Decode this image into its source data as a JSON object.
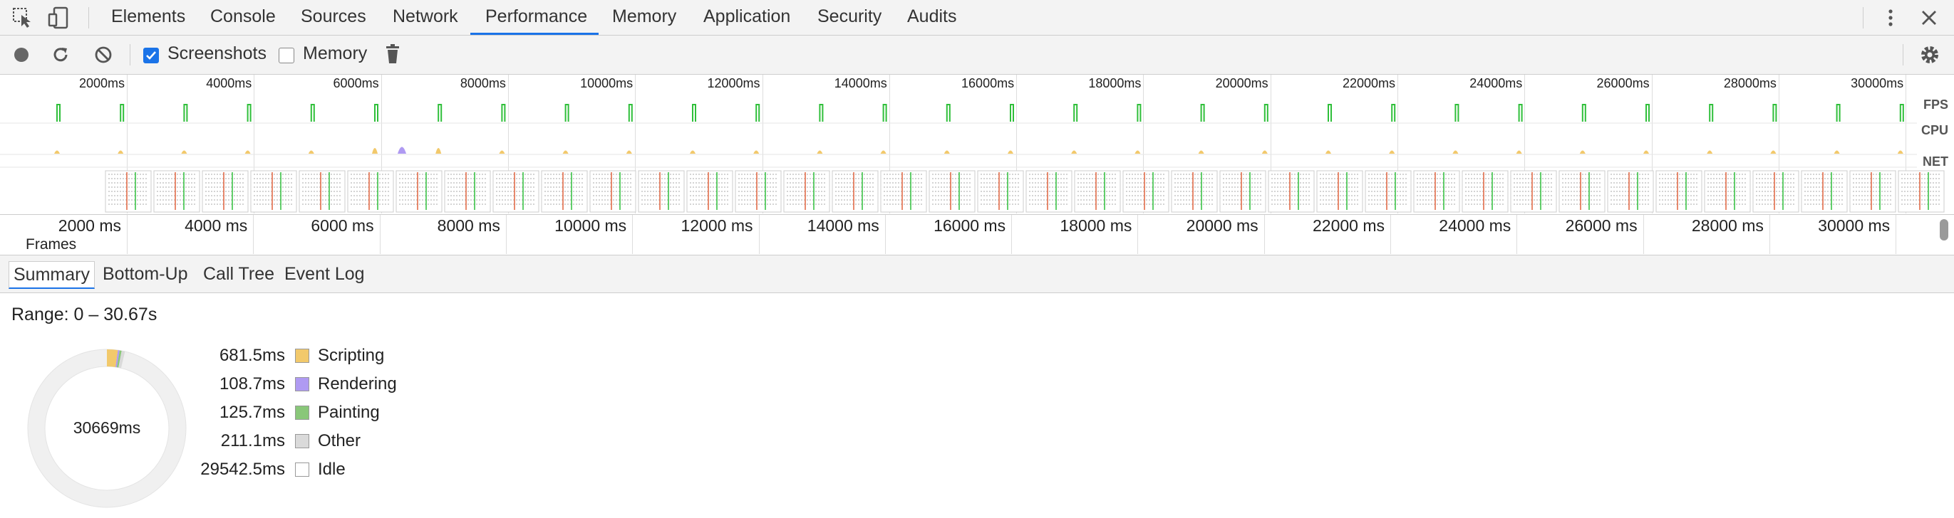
{
  "tabs": [
    {
      "label": "Elements"
    },
    {
      "label": "Console"
    },
    {
      "label": "Sources"
    },
    {
      "label": "Network"
    },
    {
      "label": "Performance",
      "active": true
    },
    {
      "label": "Memory"
    },
    {
      "label": "Application"
    },
    {
      "label": "Security"
    },
    {
      "label": "Audits"
    }
  ],
  "toolbar": {
    "screenshots_label": "Screenshots",
    "screenshots_checked": true,
    "memory_label": "Memory",
    "memory_checked": false
  },
  "overview": {
    "ticks": [
      "2000ms",
      "4000ms",
      "6000ms",
      "8000ms",
      "10000ms",
      "12000ms",
      "14000ms",
      "16000ms",
      "18000ms",
      "20000ms",
      "22000ms",
      "24000ms",
      "26000ms",
      "28000ms",
      "30000ms"
    ],
    "fps_label": "FPS",
    "cpu_label": "CPU",
    "net_label": "NET"
  },
  "ruler": {
    "ticks": [
      "2000 ms",
      "4000 ms",
      "6000 ms",
      "8000 ms",
      "10000 ms",
      "12000 ms",
      "14000 ms",
      "16000 ms",
      "18000 ms",
      "20000 ms",
      "22000 ms",
      "24000 ms",
      "26000 ms",
      "28000 ms",
      "30000 ms"
    ],
    "frames_label": "Frames"
  },
  "bottom_tabs": [
    {
      "label": "Summary",
      "active": true
    },
    {
      "label": "Bottom-Up"
    },
    {
      "label": "Call Tree"
    },
    {
      "label": "Event Log"
    }
  ],
  "summary": {
    "range": "Range: 0 – 30.67s",
    "total": "30669ms",
    "legend": [
      {
        "value": "681.5ms",
        "name": "Scripting",
        "color": "#f2c96b"
      },
      {
        "value": "108.7ms",
        "name": "Rendering",
        "color": "#af9af2"
      },
      {
        "value": "125.7ms",
        "name": "Painting",
        "color": "#89c779"
      },
      {
        "value": "211.1ms",
        "name": "Other",
        "color": "#dadada"
      },
      {
        "value": "29542.5ms",
        "name": "Idle",
        "color": "#ffffff"
      }
    ]
  },
  "colors": {
    "accent": "#1a73e8",
    "fps": "#2fbf3a",
    "cpu_scripting": "#f2c96b",
    "cpu_rendering": "#af9af2"
  }
}
